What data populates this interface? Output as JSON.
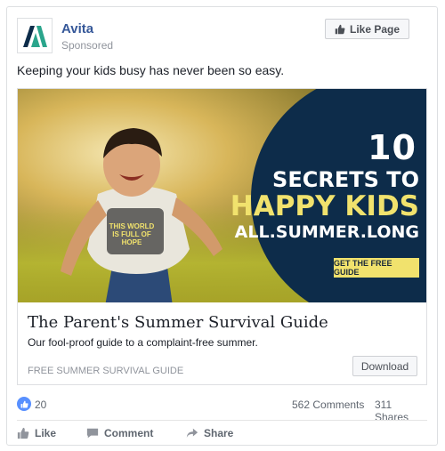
{
  "post": {
    "page_name": "Avita",
    "sponsored_label": "Sponsored",
    "like_page_label": "Like Page",
    "message": "Keeping your kids busy has never been so easy."
  },
  "hero": {
    "line_number": "10",
    "line_secrets": "SECRETS TO",
    "line_happy": "HAPPY KIDS",
    "line_all": "ALL.SUMMER.LONG",
    "cta_label": "GET THE FREE GUIDE",
    "shirt_text": "THIS WORLD IS FULL OF HOPE"
  },
  "card": {
    "title": "The Parent's Summer Survival Guide",
    "description": "Our fool-proof guide to a complaint-free summer.",
    "domain": "FREE SUMMER SURVIVAL GUIDE",
    "button_label": "Download"
  },
  "stats": {
    "likes": "20",
    "comments": "562 Comments",
    "shares": "311 Shares"
  },
  "actions": {
    "like": "Like",
    "comment": "Comment",
    "share": "Share"
  },
  "colors": {
    "brand_blue": "#365899",
    "panel_navy": "#0d2c4a",
    "accent_yellow": "#f1e26d",
    "like_blue": "#5890ff"
  },
  "icons": [
    "avita-logo",
    "thumbs-up-icon",
    "comment-icon",
    "share-icon"
  ]
}
